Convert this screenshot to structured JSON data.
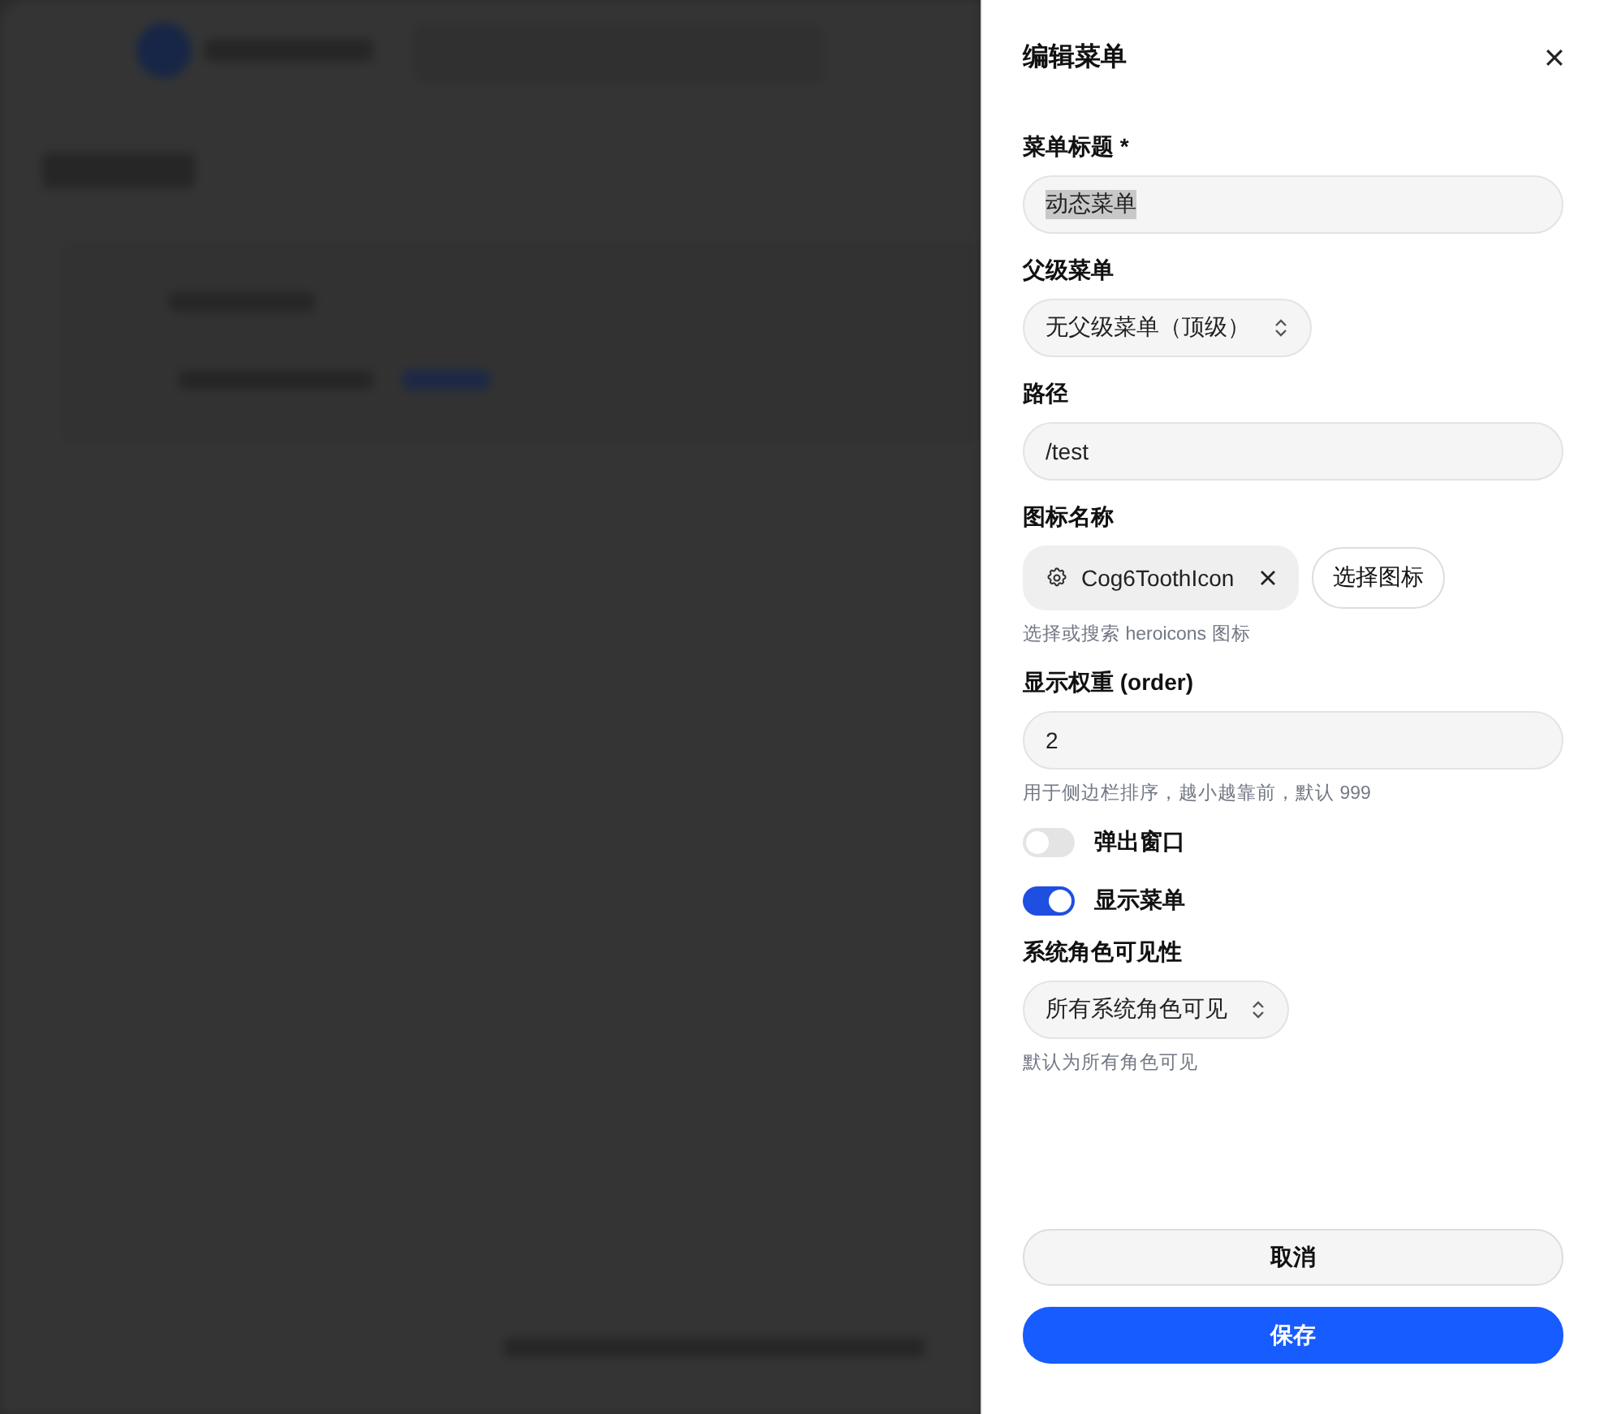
{
  "drawer": {
    "title": "编辑菜单",
    "fields": [
      {
        "kind": "text",
        "label": "菜单标题 *",
        "value": "动态菜单",
        "text_selected": true
      },
      {
        "kind": "select",
        "label": "父级菜单",
        "value": "无父级菜单（顶级）"
      },
      {
        "kind": "text",
        "label": "路径",
        "value": "/test",
        "text_selected": false
      },
      {
        "kind": "icon_picker",
        "label": "图标名称",
        "value": "Cog6ToothIcon",
        "button": "选择图标",
        "hint": "选择或搜索 heroicons 图标"
      },
      {
        "kind": "text",
        "label": "显示权重 (order)",
        "value": "2",
        "text_selected": false,
        "hint": "用于侧边栏排序，越小越靠前，默认 999"
      },
      {
        "kind": "toggle",
        "label": "弹出窗口",
        "on": false
      },
      {
        "kind": "toggle",
        "label": "显示菜单",
        "on": true
      },
      {
        "kind": "select",
        "label": "系统角色可见性",
        "value": "所有系统角色可见",
        "hint": "默认为所有角色可见"
      }
    ],
    "actions": [
      {
        "kind": "secondary",
        "label": "取消"
      },
      {
        "kind": "primary",
        "label": "保存"
      }
    ]
  }
}
